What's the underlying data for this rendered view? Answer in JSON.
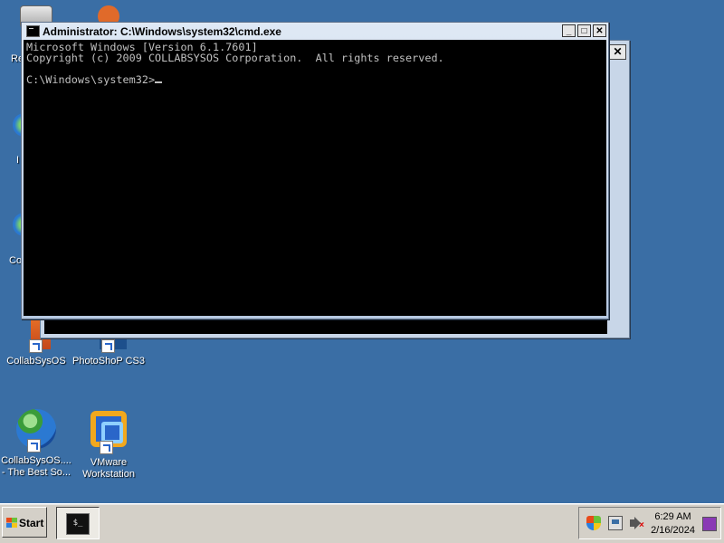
{
  "desktop": {
    "icons": [
      {
        "id": "collabsysos",
        "label": "CollabSysOS"
      },
      {
        "id": "photoshop",
        "label": "PhotoShoP CS3"
      },
      {
        "id": "collabsysos-web",
        "label_line1": "CollabSysOS....",
        "label_line2": "- The Best So..."
      },
      {
        "id": "vmware",
        "label_line1": "VMware",
        "label_line2": "Workstation"
      }
    ],
    "partial_labels": [
      "Re",
      "I",
      "Co"
    ]
  },
  "cmd_window": {
    "title": "Administrator: C:\\Windows\\system32\\cmd.exe",
    "controls": {
      "minimize": "_",
      "maximize": "□",
      "close": "✕"
    },
    "console_lines": [
      "Microsoft Windows [Version 6.1.7601]",
      "Copyright (c) 2009 COLLABSYSOS Corporation.  All rights reserved.",
      "",
      "C:\\Windows\\system32>"
    ]
  },
  "background_window": {
    "close": "✕"
  },
  "taskbar": {
    "start_label": "Start",
    "task_button_glyph": "$_",
    "clock": {
      "time": "6:29 AM",
      "date": "2/16/2024"
    },
    "tray_icons": [
      "action-center-icon",
      "network-icon",
      "volume-muted-icon"
    ]
  }
}
